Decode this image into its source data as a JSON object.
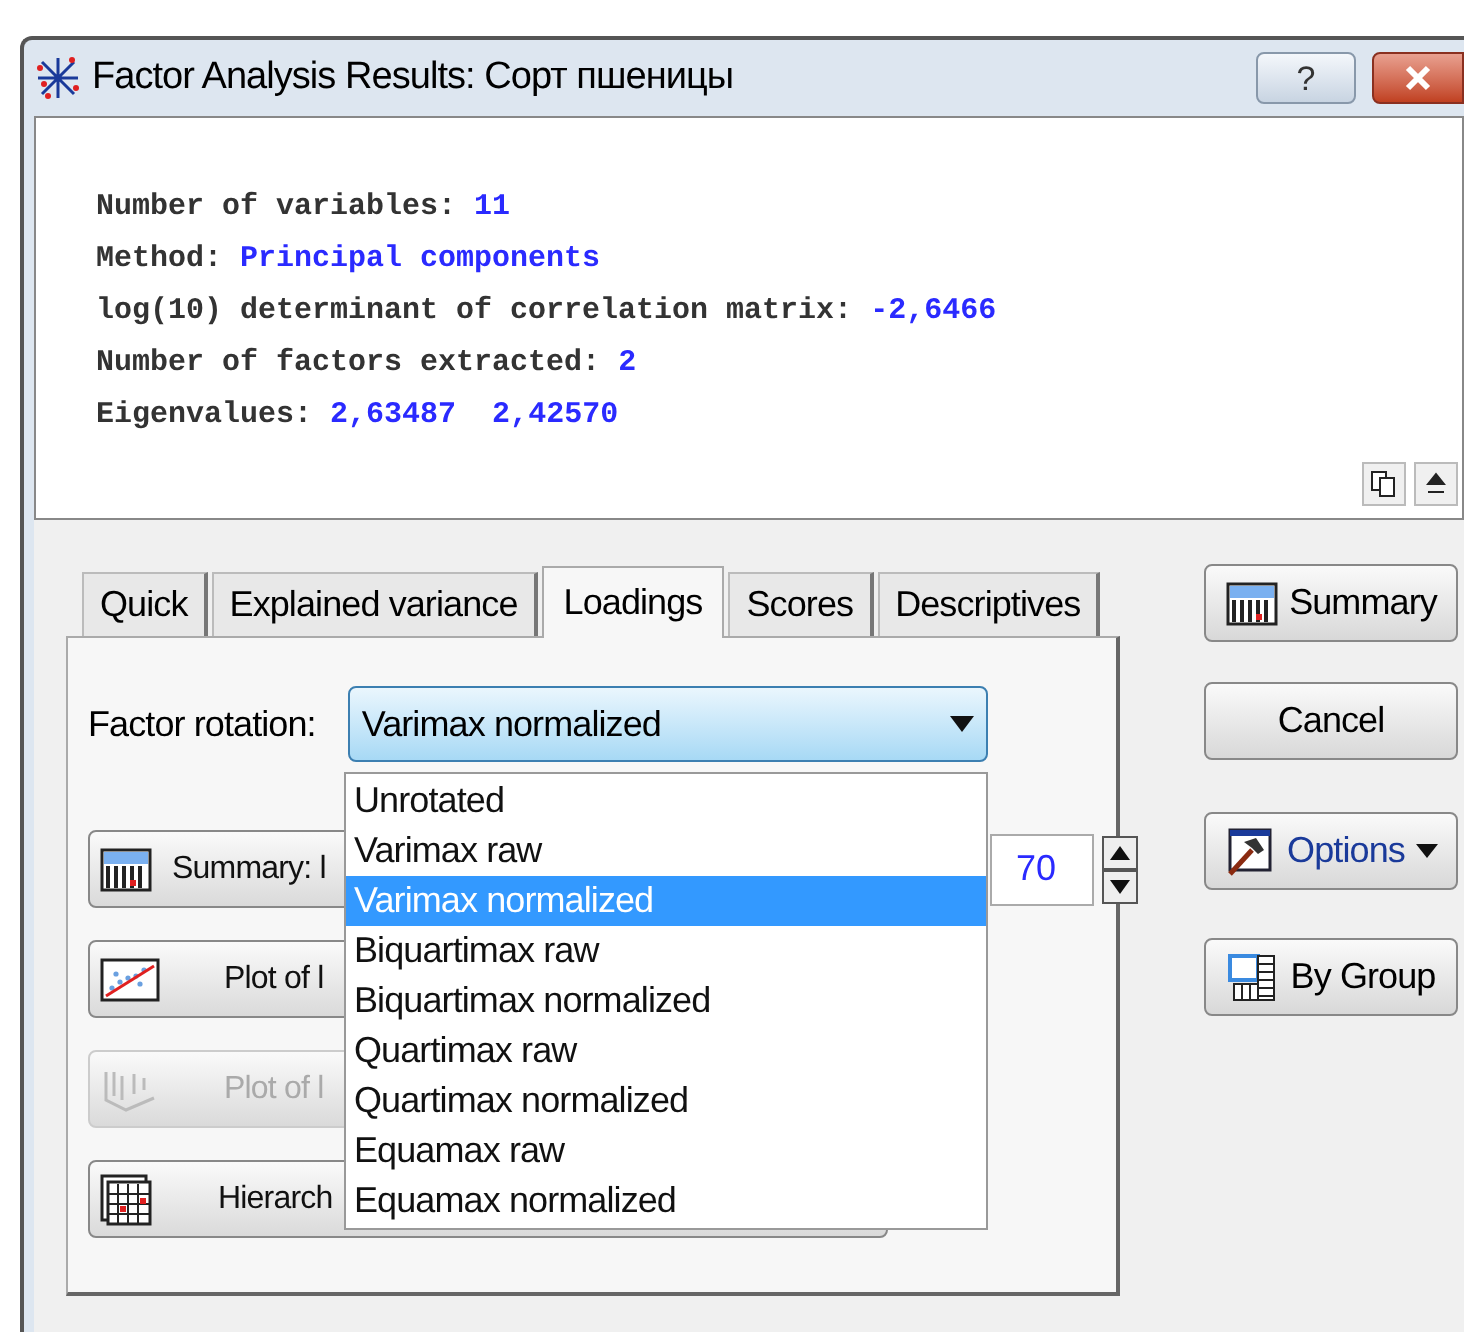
{
  "window": {
    "title": "Factor Analysis Results: Сорт пшеницы",
    "buttons": [
      "?"
    ]
  },
  "output": {
    "lines": [
      {
        "label": "Number of variables:",
        "value": "11"
      },
      {
        "label": "Method:",
        "value": "Principal components"
      },
      {
        "label": "log(10) determinant of correlation matrix:",
        "value": "-2,6466"
      },
      {
        "label": "Number of factors extracted:",
        "value": "2"
      },
      {
        "label": "Eigenvalues:",
        "value": "2,63487  2,42570"
      }
    ]
  },
  "tabs": [
    {
      "label": "Quick",
      "selected": false
    },
    {
      "label": "Explained variance",
      "selected": false
    },
    {
      "label": "Loadings",
      "selected": true
    },
    {
      "label": "Scores",
      "selected": false
    },
    {
      "label": "Descriptives",
      "selected": false
    }
  ],
  "factor_rotation": {
    "label": "Factor rotation:",
    "value": "Varimax normalized",
    "expanded": true,
    "options": [
      {
        "label": "Unrotated",
        "selected": false
      },
      {
        "label": "Varimax raw",
        "selected": false
      },
      {
        "label": "Varimax normalized",
        "selected": true
      },
      {
        "label": "Biquartimax raw",
        "selected": false
      },
      {
        "label": "Biquartimax normalized",
        "selected": false
      },
      {
        "label": "Quartimax raw",
        "selected": false
      },
      {
        "label": "Quartimax normalized",
        "selected": false
      },
      {
        "label": "Equamax raw",
        "selected": false
      },
      {
        "label": "Equamax normalized",
        "selected": false
      }
    ]
  },
  "panel_buttons": [
    {
      "kind": "summary",
      "label": "Summary: l",
      "disabled": false
    },
    {
      "kind": "plot",
      "label": "Plot of l",
      "disabled": false
    },
    {
      "kind": "plot3d",
      "label": "Plot of l",
      "disabled": true
    },
    {
      "kind": "hierarchical",
      "label": "Hierarch",
      "disabled": false
    }
  ],
  "spin_value": "70",
  "side_buttons": [
    {
      "kind": "summary",
      "label": "Summary"
    },
    {
      "kind": "plain",
      "label": "Cancel"
    },
    {
      "kind": "options",
      "label": "Options"
    },
    {
      "kind": "group",
      "label": "By Group"
    }
  ]
}
